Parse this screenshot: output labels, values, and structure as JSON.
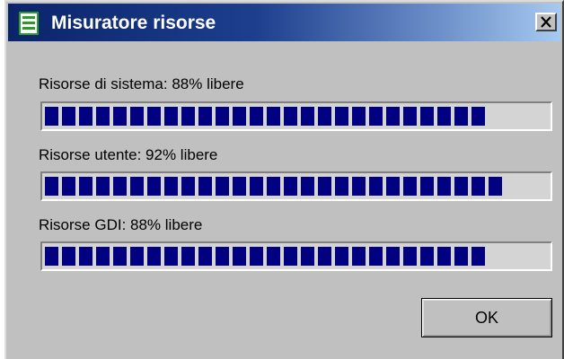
{
  "window": {
    "title": "Misuratore risorse",
    "title_icon": "resource-meter-icon",
    "close_icon": "close-icon"
  },
  "meters": [
    {
      "label": "Risorse di sistema: 88% libere",
      "percent_free": 88
    },
    {
      "label": "Risorse utente: 92% libere",
      "percent_free": 92
    },
    {
      "label": "Risorse GDI: 88% libere",
      "percent_free": 88
    }
  ],
  "buttons": {
    "ok_label": "OK"
  },
  "colors": {
    "titlebar_start": "#0a246a",
    "titlebar_end": "#a6caf0",
    "bar_fill": "#000080",
    "window_face": "#c0c0c0"
  }
}
